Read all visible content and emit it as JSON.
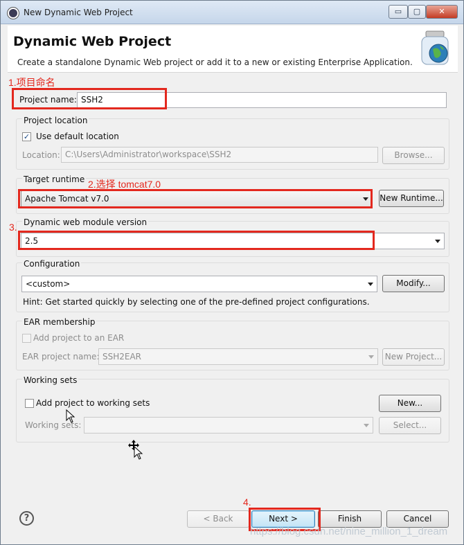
{
  "window": {
    "title": "New Dynamic Web Project",
    "controls": {
      "minimize": "▭",
      "maximize": "▢",
      "close": "✕"
    }
  },
  "header": {
    "title": "Dynamic Web Project",
    "description": "Create a standalone Dynamic Web project or add it to a new or existing Enterprise Application."
  },
  "annotations": {
    "step1": "1.项目命名",
    "step2": "2.选择 tomcat7.0",
    "step3": "3.",
    "step4": "4.",
    "color": "#e3281e"
  },
  "project_name": {
    "label": "Project name:",
    "value": "SSH2"
  },
  "project_location": {
    "group_label": "Project location",
    "use_default_label": "Use default location",
    "use_default_checked": true,
    "location_label": "Location:",
    "location_value": "C:\\Users\\Administrator\\workspace\\SSH2",
    "browse_label": "Browse..."
  },
  "target_runtime": {
    "group_label": "Target runtime",
    "selected": "Apache Tomcat v7.0",
    "new_runtime_label": "New Runtime..."
  },
  "module_version": {
    "group_label": "Dynamic web module version",
    "selected": "2.5"
  },
  "configuration": {
    "group_label": "Configuration",
    "selected": "<custom>",
    "modify_label": "Modify...",
    "hint": "Hint: Get started quickly by selecting one of the pre-defined project configurations."
  },
  "ear_membership": {
    "group_label": "EAR membership",
    "add_label": "Add project to an EAR",
    "ear_name_label": "EAR project name:",
    "ear_name_value": "SSH2EAR",
    "new_project_label": "New Project..."
  },
  "working_sets": {
    "group_label": "Working sets",
    "add_label": "Add project to working sets",
    "new_label": "New...",
    "sets_label": "Working sets:",
    "select_label": "Select..."
  },
  "footer": {
    "help": "?",
    "back_label": "< Back",
    "next_label": "Next >",
    "finish_label": "Finish",
    "cancel_label": "Cancel"
  },
  "watermark": "https://blog.csdn.net/nine_million_1_dream",
  "icons": {
    "app": "eclipse-icon",
    "header": "web-project-jar-icon",
    "help": "help-icon",
    "check": "✓"
  }
}
